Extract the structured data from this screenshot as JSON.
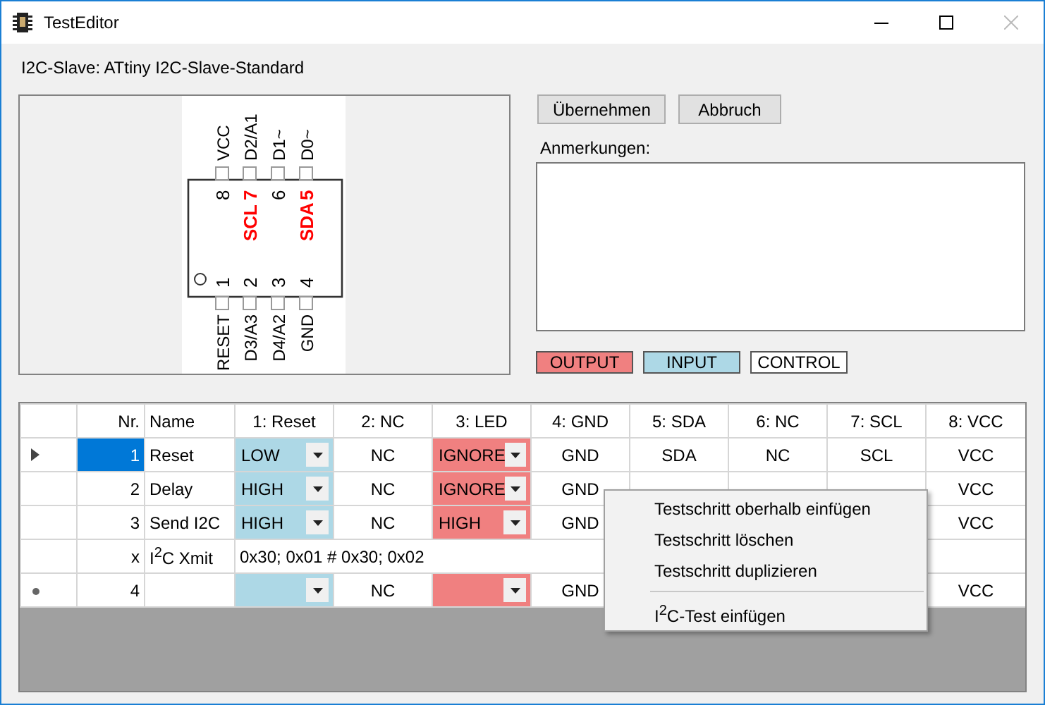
{
  "window": {
    "title": "TestEditor",
    "close_disabled": true
  },
  "slave_label": "I2C-Slave: ATtiny I2C-Slave-Standard",
  "chip": {
    "top_pins": [
      {
        "label": "VCC",
        "number": "8",
        "color": "#000000"
      },
      {
        "label": "D2/A1",
        "number": "7",
        "function": "SCL",
        "color": "#ff0000"
      },
      {
        "label": "D1~",
        "number": "6",
        "color": "#000000"
      },
      {
        "label": "D0~",
        "number": "5",
        "function": "SDA",
        "color": "#ff0000"
      }
    ],
    "bottom_pins": [
      {
        "label": "RESET",
        "number": "1",
        "color": "#000000"
      },
      {
        "label": "D3/A3",
        "number": "2",
        "color": "#000000"
      },
      {
        "label": "D4/A2",
        "number": "3",
        "color": "#000000"
      },
      {
        "label": "GND",
        "number": "4",
        "color": "#000000"
      }
    ]
  },
  "buttons": [
    "Übernehmen",
    "Abbruch"
  ],
  "notes": {
    "label": "Anmerkungen:"
  },
  "legend": [
    {
      "label": "OUTPUT",
      "color": "#f08080"
    },
    {
      "label": "INPUT",
      "color": "#add8e6"
    },
    {
      "label": "CONTROL",
      "color": "#ffffff"
    }
  ],
  "grid": {
    "columns": [
      "Nr.",
      "Name",
      "1: Reset",
      "2: NC",
      "3: LED",
      "4: GND",
      "5: SDA",
      "6: NC",
      "7: SCL",
      "8: VCC"
    ],
    "rows": [
      {
        "kind": "step",
        "current": true,
        "new_row": false,
        "selected": true,
        "nr": "1",
        "name": "Reset",
        "cells": [
          {
            "kind": "input",
            "value": "LOW"
          },
          {
            "kind": "fixed",
            "value": "NC"
          },
          {
            "kind": "output",
            "value": "IGNORE"
          },
          {
            "kind": "fixed",
            "value": "GND"
          },
          {
            "kind": "fixed",
            "value": "SDA"
          },
          {
            "kind": "fixed",
            "value": "NC"
          },
          {
            "kind": "fixed",
            "value": "SCL"
          },
          {
            "kind": "fixed",
            "value": "VCC"
          }
        ]
      },
      {
        "kind": "step",
        "current": false,
        "new_row": false,
        "selected": false,
        "nr": "2",
        "name": "Delay",
        "cells": [
          {
            "kind": "input",
            "value": "HIGH"
          },
          {
            "kind": "fixed",
            "value": "NC"
          },
          {
            "kind": "output",
            "value": "IGNORE"
          },
          {
            "kind": "fixed",
            "value": "GND"
          },
          {
            "kind": "fixed"
          },
          {
            "kind": "fixed"
          },
          {
            "kind": "fixed"
          },
          {
            "kind": "fixed",
            "value": "VCC"
          }
        ]
      },
      {
        "kind": "step",
        "current": false,
        "new_row": false,
        "selected": false,
        "nr": "3",
        "name": "Send I2C",
        "cells": [
          {
            "kind": "input",
            "value": "HIGH"
          },
          {
            "kind": "fixed",
            "value": "NC"
          },
          {
            "kind": "output",
            "value": "HIGH"
          },
          {
            "kind": "fixed",
            "value": "GND"
          },
          {
            "kind": "fixed"
          },
          {
            "kind": "fixed"
          },
          {
            "kind": "fixed"
          },
          {
            "kind": "fixed",
            "value": "VCC"
          }
        ]
      },
      {
        "kind": "i2c",
        "current": false,
        "new_row": false,
        "selected": false,
        "nr": "x",
        "name": "I$^{2}$C Xmit",
        "data": "0x30; 0x01 # 0x30; 0x02"
      },
      {
        "kind": "step",
        "current": false,
        "new_row": true,
        "selected": false,
        "nr": "4",
        "cells": [
          {
            "kind": "input"
          },
          {
            "kind": "fixed",
            "value": "NC"
          },
          {
            "kind": "output"
          },
          {
            "kind": "fixed",
            "value": "GND"
          },
          {
            "kind": "fixed"
          },
          {
            "kind": "fixed"
          },
          {
            "kind": "fixed"
          },
          {
            "kind": "fixed",
            "value": "VCC"
          }
        ]
      }
    ]
  },
  "context_menu": [
    {
      "kind": "item",
      "label": "Testschritt oberhalb einfügen"
    },
    {
      "kind": "item",
      "label": "Testschritt löschen"
    },
    {
      "kind": "item",
      "label": "Testschritt duplizieren"
    },
    {
      "kind": "separator"
    },
    {
      "kind": "item",
      "label": "I$^{2}$C-Test einfügen"
    }
  ]
}
